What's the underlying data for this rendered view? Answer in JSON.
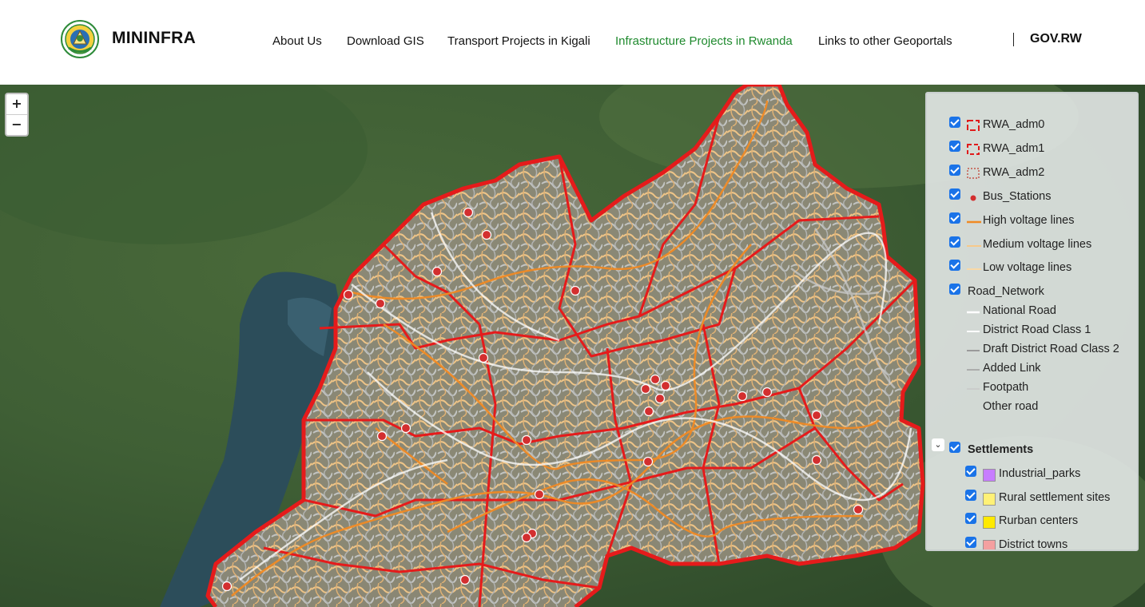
{
  "header": {
    "brand": "MININFRA",
    "nav": [
      {
        "label": "About Us"
      },
      {
        "label": "Download GIS"
      },
      {
        "label": "Transport Projects in Kigali"
      },
      {
        "label": "Infrastructure Projects in Rwanda",
        "active": true
      },
      {
        "label": "Links to other Geoportals"
      }
    ],
    "gov_link": "GOV.RW",
    "active_color": "#1f8a2e"
  },
  "map": {
    "zoom_in": "+",
    "zoom_out": "−"
  },
  "legend": {
    "layers": [
      {
        "label": "RWA_adm0",
        "checked": true,
        "symbol": "dashed-box",
        "color": "#e01b1b"
      },
      {
        "label": "RWA_adm1",
        "checked": true,
        "symbol": "dashed-box",
        "color": "#e01b1b"
      },
      {
        "label": "RWA_adm2",
        "checked": true,
        "symbol": "dotted-box",
        "color": "#c0392b"
      },
      {
        "label": "Bus_Stations",
        "checked": true,
        "symbol": "dot",
        "color": "#d32f2f"
      },
      {
        "label": "High voltage lines",
        "checked": true,
        "symbol": "line",
        "color": "#f08a24"
      },
      {
        "label": "Medium voltage lines",
        "checked": true,
        "symbol": "line",
        "color": "#f7c98b"
      },
      {
        "label": "Low voltage lines",
        "checked": true,
        "symbol": "line",
        "color": "#f9d9a6"
      },
      {
        "label": "Road_Network",
        "checked": true,
        "symbol": "none"
      }
    ],
    "road_classes": [
      {
        "label": "National Road",
        "color": "#ffffff"
      },
      {
        "label": "District Road Class 1",
        "color": "#ffffff"
      },
      {
        "label": "Draft District Road Class 2",
        "color": "#9a9a9a"
      },
      {
        "label": "Added Link",
        "color": "#a8a8a8"
      },
      {
        "label": "Footpath",
        "color": "#c4c4c4"
      },
      {
        "label": "Other road",
        "color": ""
      }
    ],
    "settlements_title": "Settlements",
    "settlements": [
      {
        "label": "Industrial_parks",
        "checked": true,
        "color": "#c77dff"
      },
      {
        "label": "Rural settlement sites",
        "checked": true,
        "color": "#fff176"
      },
      {
        "label": "Rurban centers",
        "checked": true,
        "color": "#ffea00"
      },
      {
        "label": "District towns",
        "checked": true,
        "color": "#f4a0a0"
      }
    ]
  }
}
